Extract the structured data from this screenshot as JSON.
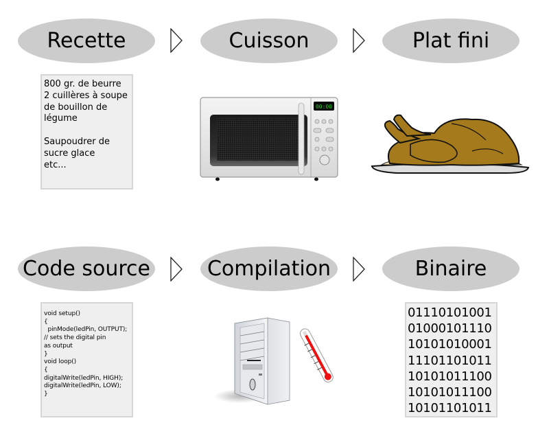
{
  "rows": [
    {
      "stages": [
        {
          "label": "Recette"
        },
        {
          "label": "Cuisson"
        },
        {
          "label": "Plat fini"
        }
      ],
      "recipe_text": "800 gr. de beurre\n2 cuillères à soupe\nde bouillon de\nlégume\n\nSaupoudrer de\nsucre glace\netc...",
      "process_illustration": "microwave-icon",
      "microwave_display": "00:00",
      "result_illustration": "roast-turkey-icon"
    },
    {
      "stages": [
        {
          "label": "Code source"
        },
        {
          "label": "Compilation"
        },
        {
          "label": "Binaire"
        }
      ],
      "code_text": "void setup()\n{\n  pinMode(ledPin, OUTPUT);\n// sets the digital pin\nas output\n}\nvoid loop()\n{\ndigitalWrite(ledPin, HIGH);\ndigitalWrite(ledPin, LOW);\n}",
      "process_illustration": "computer-tower-thermometer-icon",
      "binary_lines": [
        "01110101001",
        "01000101110",
        "10101010001",
        "11101101011",
        "10101011100",
        "10101011100",
        "10101101011"
      ]
    }
  ],
  "colors": {
    "ellipse_fill": "#cccccc",
    "box_fill": "#efefef",
    "box_border": "#d6d6d6",
    "display_digits": "#22cc22",
    "thermometer_red": "#ee1111",
    "turkey_brown": "#a57a1c"
  }
}
